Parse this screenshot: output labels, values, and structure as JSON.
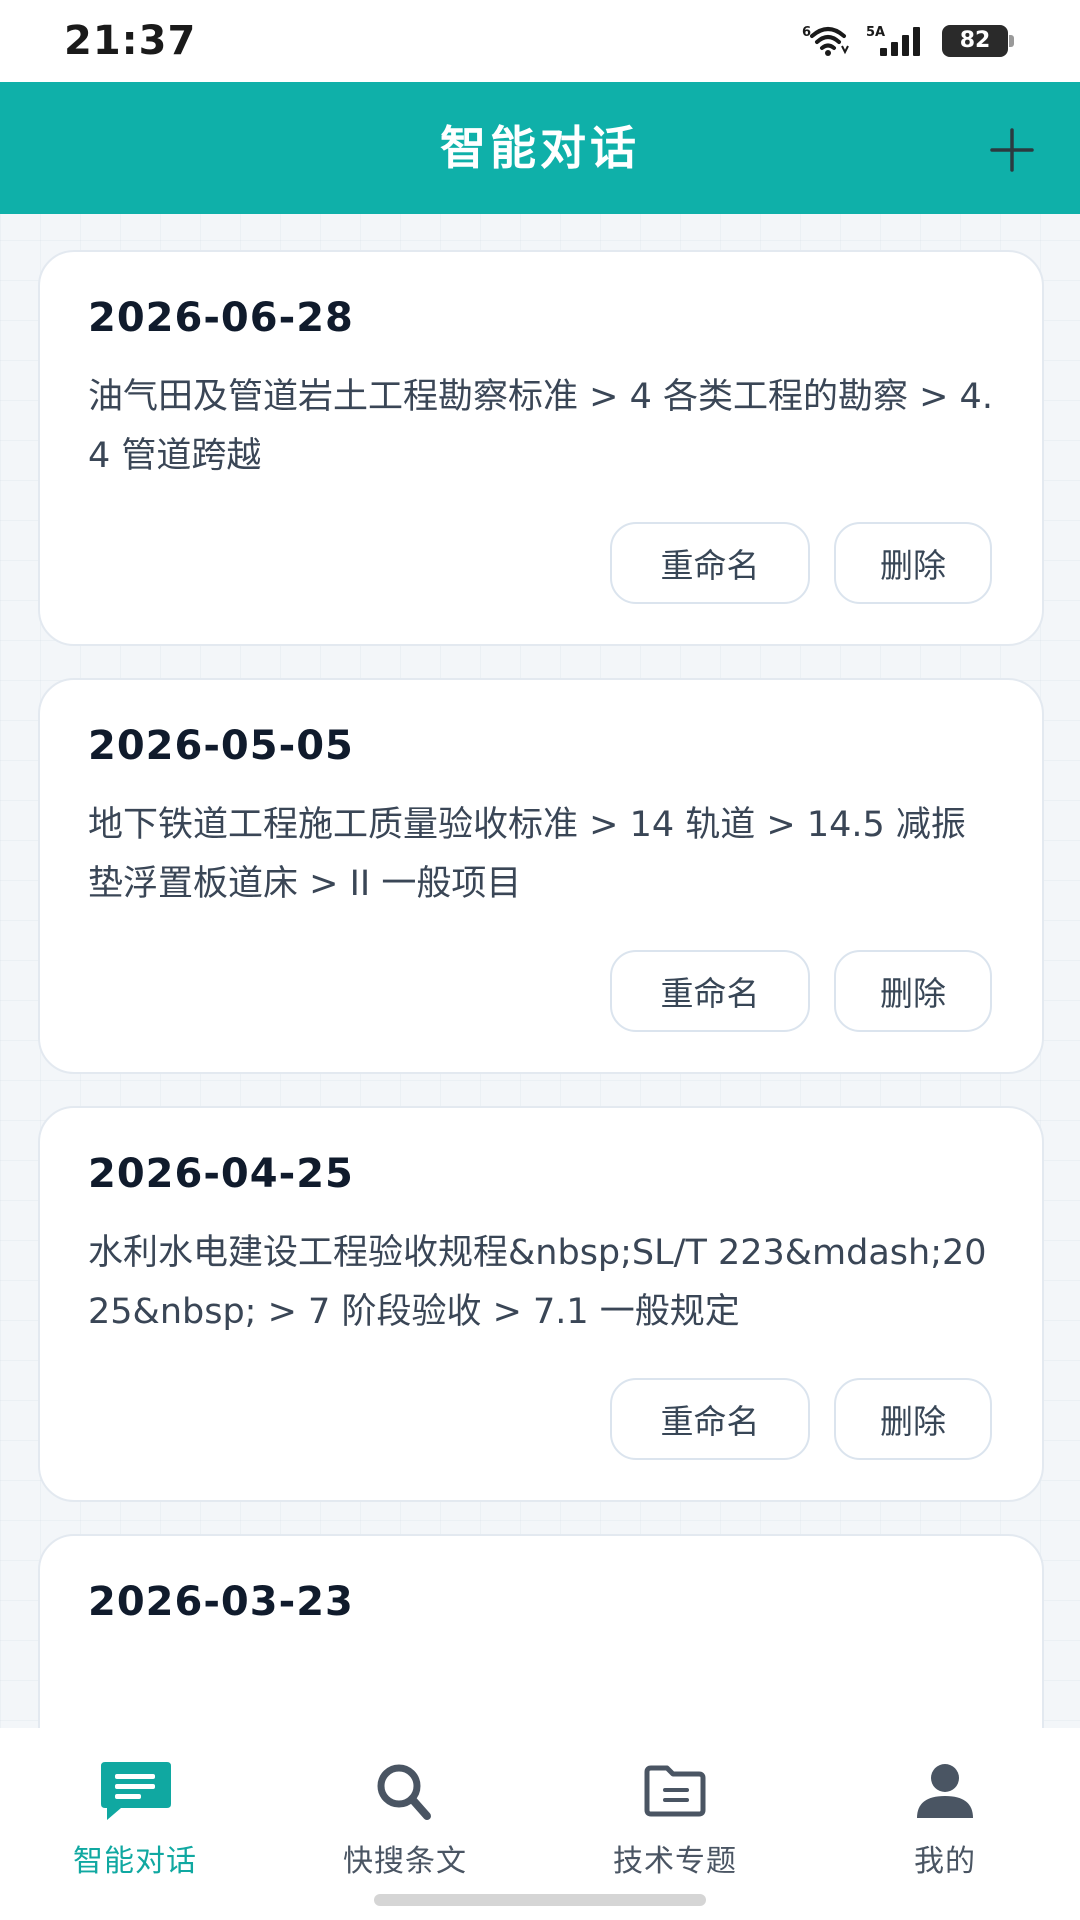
{
  "status_bar": {
    "time": "21:37",
    "wifi_badge": "6",
    "signal_badge": "5A",
    "battery_level": "82"
  },
  "header": {
    "title": "智能对话",
    "add_icon": "plus-icon"
  },
  "conversations": [
    {
      "date": "2026-06-28",
      "title": "油气田及管道岩土工程勘察标准 > 4 各类工程的勘察 > 4.4 管道跨越",
      "rename_label": "重命名",
      "delete_label": "删除"
    },
    {
      "date": "2026-05-05",
      "title": "地下铁道工程施工质量验收标准 > 14 轨道 > 14.5 减振垫浮置板道床 > II 一般项目",
      "rename_label": "重命名",
      "delete_label": "删除"
    },
    {
      "date": "2026-04-25",
      "title": "水利水电建设工程验收规程&nbsp;SL/T 223&mdash;2025&nbsp; > 7 阶段验收 > 7.1 一般规定",
      "rename_label": "重命名",
      "delete_label": "删除"
    },
    {
      "date": "2026-03-23"
    }
  ],
  "bottom_nav": {
    "items": [
      {
        "label": "智能对话",
        "icon": "chat-icon",
        "active": true
      },
      {
        "label": "快搜条文",
        "icon": "search-icon",
        "active": false
      },
      {
        "label": "技术专题",
        "icon": "folder-icon",
        "active": false
      },
      {
        "label": "我的",
        "icon": "user-icon",
        "active": false
      }
    ]
  },
  "colors": {
    "accent": "#0fb0a9",
    "nav_active": "#10a8a1"
  }
}
